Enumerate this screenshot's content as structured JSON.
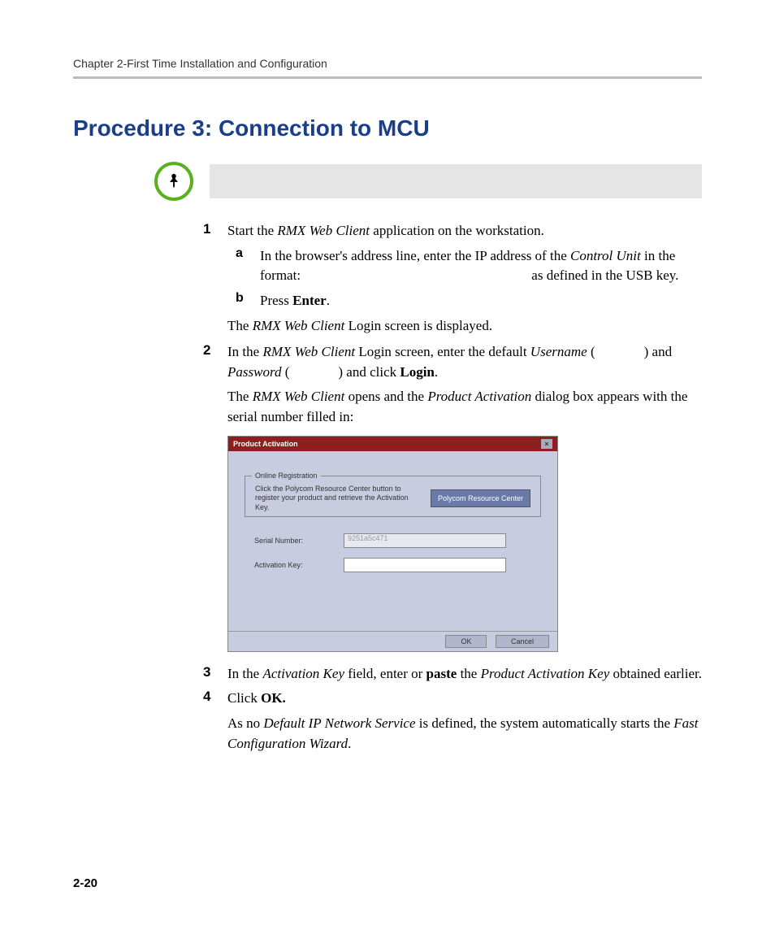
{
  "chapterHeader": "Chapter 2-First Time Installation and Configuration",
  "heading": "Procedure 3: Connection to MCU",
  "steps": {
    "s1": {
      "num": "1",
      "text_a": "Start the ",
      "text_b": "RMX Web Client",
      "text_c": " application on the workstation."
    },
    "s1a": {
      "let": "a",
      "t1": "In the browser's address line, enter the IP address of the ",
      "t2": "Control Unit",
      "t3": " in the format:",
      "t4": " as defined in the USB key."
    },
    "s1b": {
      "let": "b",
      "t1": "Press ",
      "t2": "Enter",
      "t3": "."
    },
    "s1post": {
      "t1": "The ",
      "t2": "RMX Web Client",
      "t3": " Login screen is displayed."
    },
    "s2": {
      "num": "2",
      "t1": "In the ",
      "t2": "RMX Web Client",
      "t3": " Login screen, enter the default ",
      "t4": "Username",
      "t5": " (",
      "t6": ") and ",
      "t7": "Password",
      "t8": " (",
      "t9": ") and click ",
      "t10": "Login",
      "t11": "."
    },
    "s2post": {
      "t1": "The ",
      "t2": "RMX Web Client",
      "t3": " opens and the ",
      "t4": "Product Activation",
      "t5": " dialog box appears with the serial number filled in:"
    },
    "s3": {
      "num": "3",
      "t1": "In the ",
      "t2": "Activation Key",
      "t3": " field, enter or ",
      "t4": "paste",
      "t5": " the ",
      "t6": "Product Activation Key",
      "t7": " obtained earlier."
    },
    "s4": {
      "num": "4",
      "t1": "Click ",
      "t2": "OK."
    },
    "s4post": {
      "t1": "As no ",
      "t2": "Default IP Network Service",
      "t3": " is defined, the system automatically starts the ",
      "t4": "Fast Configuration Wizard",
      "t5": "."
    }
  },
  "dialog": {
    "title": "Product Activation",
    "legend": "Online Registration",
    "instr": "Click the Polycom Resource Center button to register your product and retrieve the Activation Key.",
    "prcBtn": "Polycom Resource Center",
    "serialLabel": "Serial Number:",
    "serialValue": "9251a5c471",
    "actLabel": "Activation Key:",
    "ok": "OK",
    "cancel": "Cancel"
  },
  "pageNum": "2-20"
}
